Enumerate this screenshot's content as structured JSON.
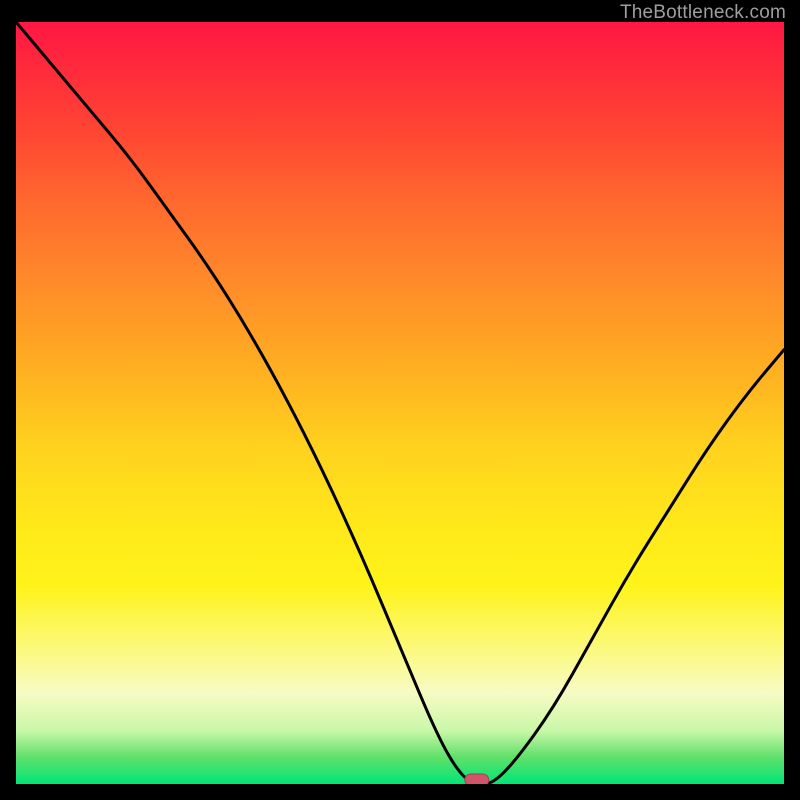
{
  "watermark": "TheBottleneck.com",
  "chart_data": {
    "type": "line",
    "title": "",
    "xlabel": "",
    "ylabel": "",
    "xlim": [
      0,
      100
    ],
    "ylim": [
      0,
      100
    ],
    "grid": false,
    "legend": false,
    "background_gradient": {
      "top": "#ff1744",
      "upper_mid": "#ff8a2a",
      "mid": "#ffe81a",
      "lower_mid": "#f7fbc4",
      "bottom": "#00e676"
    },
    "series": [
      {
        "name": "bottleneck-curve",
        "x": [
          0,
          5,
          10,
          15,
          20,
          25,
          30,
          35,
          40,
          45,
          50,
          55,
          58,
          60,
          62,
          65,
          70,
          75,
          80,
          85,
          90,
          95,
          100
        ],
        "y": [
          100,
          94,
          88,
          82,
          75,
          68,
          60,
          51,
          41,
          30,
          18,
          6,
          1,
          0,
          0,
          3,
          10,
          19,
          28,
          36,
          44,
          51,
          57
        ]
      }
    ],
    "marker": {
      "name": "current-position",
      "x": 60,
      "y": 0,
      "shape": "pill",
      "color": "#d1556a"
    }
  }
}
